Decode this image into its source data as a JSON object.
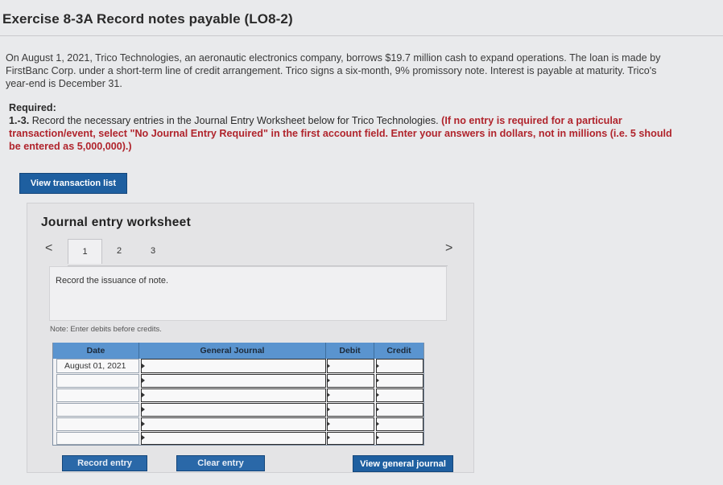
{
  "exercise": {
    "title": "Exercise 8-3A Record notes payable (LO8-2)",
    "intro": "On August 1, 2021, Trico Technologies, an aeronautic electronics company, borrows $19.7 million cash to expand operations. The loan is made by FirstBanc Corp. under a short-term line of credit arrangement. Trico signs a six-month, 9% promissory note. Interest is payable at maturity. Trico's year-end is December 31.",
    "required_label": "Required:",
    "step": "1.-3.",
    "instruction": " Record the necessary entries in the Journal Entry Worksheet below for Trico Technologies. ",
    "instruction_emphasis": "(If no entry is required for a particular transaction/event, select \"No Journal Entry Required\" in the first account field. Enter your answers in dollars, not in millions (i.e. 5 should be entered as 5,000,000).)"
  },
  "buttons": {
    "view_transaction_list": "View transaction list",
    "record_entry": "Record entry",
    "clear_entry": "Clear entry",
    "view_general_journal": "View general journal"
  },
  "worksheet": {
    "title": "Journal entry worksheet",
    "prev": "<",
    "next": ">",
    "tabs": [
      "1",
      "2",
      "3"
    ],
    "active_tab": "1",
    "description": "Record the issuance of note.",
    "note": "Note: Enter debits before credits."
  },
  "table": {
    "headers": {
      "date": "Date",
      "general_journal": "General Journal",
      "debit": "Debit",
      "credit": "Credit"
    },
    "first_date": "August 01, 2021",
    "row_count": 6
  },
  "colors": {
    "accent": "#1e5fa0",
    "header": "#5a94cf",
    "emphasis": "#b0242c"
  }
}
